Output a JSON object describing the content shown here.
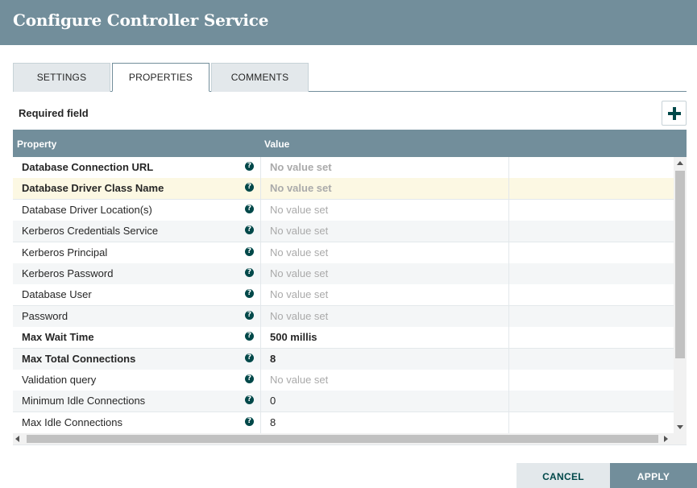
{
  "dialog": {
    "title": "Configure Controller Service"
  },
  "tabs": [
    {
      "label": "SETTINGS",
      "active": false
    },
    {
      "label": "PROPERTIES",
      "active": true
    },
    {
      "label": "COMMENTS",
      "active": false
    }
  ],
  "required_label": "Required field",
  "add_button_icon": "plus-icon",
  "grid": {
    "headers": {
      "property": "Property",
      "value": "Value"
    },
    "rows": [
      {
        "property": "Database Connection URL",
        "value": "No value set",
        "required": true,
        "value_set": false
      },
      {
        "property": "Database Driver Class Name",
        "value": "No value set",
        "required": true,
        "value_set": false,
        "selected": true
      },
      {
        "property": "Database Driver Location(s)",
        "value": "No value set",
        "required": false,
        "value_set": false
      },
      {
        "property": "Kerberos Credentials Service",
        "value": "No value set",
        "required": false,
        "value_set": false
      },
      {
        "property": "Kerberos Principal",
        "value": "No value set",
        "required": false,
        "value_set": false
      },
      {
        "property": "Kerberos Password",
        "value": "No value set",
        "required": false,
        "value_set": false
      },
      {
        "property": "Database User",
        "value": "No value set",
        "required": false,
        "value_set": false
      },
      {
        "property": "Password",
        "value": "No value set",
        "required": false,
        "value_set": false
      },
      {
        "property": "Max Wait Time",
        "value": "500 millis",
        "required": true,
        "value_set": true
      },
      {
        "property": "Max Total Connections",
        "value": "8",
        "required": true,
        "value_set": true
      },
      {
        "property": "Validation query",
        "value": "No value set",
        "required": false,
        "value_set": false
      },
      {
        "property": "Minimum Idle Connections",
        "value": "0",
        "required": false,
        "value_set": true
      },
      {
        "property": "Max Idle Connections",
        "value": "8",
        "required": false,
        "value_set": true
      }
    ]
  },
  "buttons": {
    "cancel": "CANCEL",
    "apply": "APPLY"
  },
  "colors": {
    "header": "#728e9b",
    "accent": "#004849",
    "selected_row": "#fcf8e3"
  }
}
